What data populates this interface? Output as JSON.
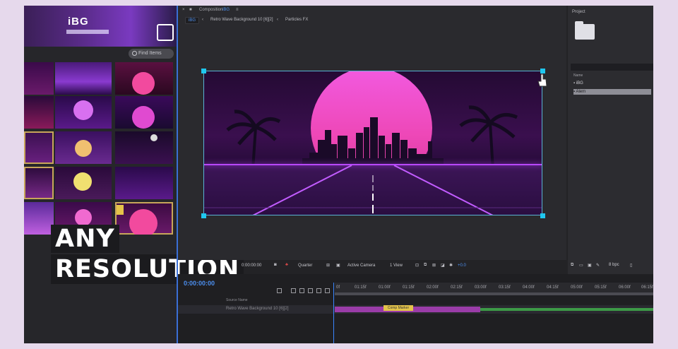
{
  "colors": {
    "accent_blue": "#3a86ff",
    "handle_cyan": "#1fc7ef",
    "neon_pink": "#f25ae0",
    "neon_purple": "#b848ff",
    "layer_purple": "#9a3ca8",
    "marker_yellow": "#e2c24a"
  },
  "left_panel": {
    "banner_logo": "iBG",
    "search_placeholder": "Find Items",
    "thumbnails_count": 15
  },
  "overlay": {
    "line1": "ANY",
    "line2": "RESOLUTION"
  },
  "composition": {
    "header_label": "Composition",
    "header_name": "iBG",
    "tabs": [
      "iBG",
      "Retro Wave Background 10 [6][2]",
      "Particles FX"
    ],
    "bottom_bar": {
      "time": "0:00:00:00",
      "zoom": "Quarter",
      "camera": "Active Camera",
      "views": "1 View",
      "exposure": "+0.0"
    }
  },
  "project": {
    "title": "Project",
    "columns": [
      "Name"
    ],
    "items": [
      {
        "name": "iBG",
        "selected": false
      },
      {
        "name": "Alem",
        "selected": true
      }
    ],
    "footer": "8 bpc"
  },
  "timeline": {
    "current_time": "0:00:00:00",
    "ruler_ticks": [
      "0f",
      "01:15f",
      "01:00f",
      "01:15f",
      "02:00f",
      "02:15f",
      "03:00f",
      "03:15f",
      "04:00f",
      "04:15f",
      "05:00f",
      "05:15f",
      "06:00f",
      "06:15f"
    ],
    "layer_name": "Retro Wave Background 10 [6][2]",
    "layer_column": "Source Name",
    "marker_label": "Comp Marker"
  }
}
